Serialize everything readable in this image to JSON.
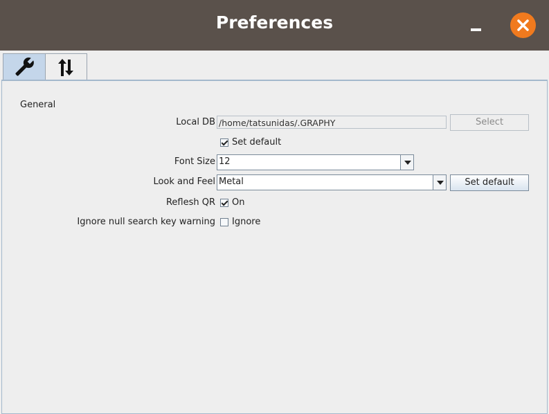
{
  "window": {
    "title": "Preferences"
  },
  "tabs": [
    {
      "icon": "wrench-icon",
      "selected": true
    },
    {
      "icon": "sort-arrows-icon",
      "selected": false
    }
  ],
  "general": {
    "section_label": "General",
    "local_db": {
      "label": "Local DB",
      "value": "/home/tatsunidas/.GRAPHY",
      "select_label": "Select",
      "select_enabled": false
    },
    "set_default_db": {
      "label": "Set default",
      "checked": true
    },
    "font_size": {
      "label": "Font Size",
      "value": "12"
    },
    "look_and_feel": {
      "label": "Look and Feel",
      "value": "Metal",
      "button_label": "Set default"
    },
    "reflesh_qr": {
      "label": "Reflesh QR",
      "checkbox_label": "On",
      "checked": true
    },
    "ignore_null": {
      "label": "Ignore null search key warning",
      "checkbox_label": "Ignore",
      "checked": false
    }
  },
  "colors": {
    "titlebar": "#5a514b",
    "close": "#f07a1e",
    "selected_tab": "#c4d6ea"
  }
}
